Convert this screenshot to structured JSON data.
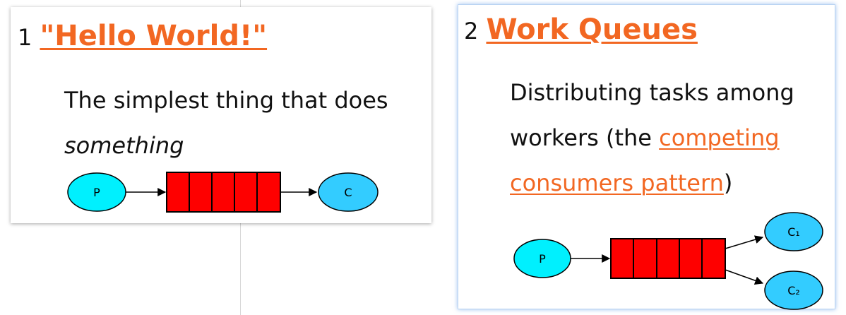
{
  "tutorials": [
    {
      "number": "1",
      "title": "\"Hello World!\"",
      "description_before": "The simplest thing that does ",
      "description_em": "something",
      "diagram": {
        "producer": "P",
        "consumer": "C"
      }
    },
    {
      "number": "2",
      "title": "Work Queues",
      "description_before": "Distributing tasks among workers (the ",
      "description_link": "competing consumers pattern",
      "description_after": ")",
      "diagram": {
        "producer": "P",
        "consumers": [
          "C₁",
          "C₂"
        ]
      }
    }
  ],
  "colors": {
    "link": "#f26722",
    "producer": "#00f0fe",
    "consumer": "#33ccff",
    "queue": "#fe0000",
    "focus_glow": "#b9d3f2"
  }
}
